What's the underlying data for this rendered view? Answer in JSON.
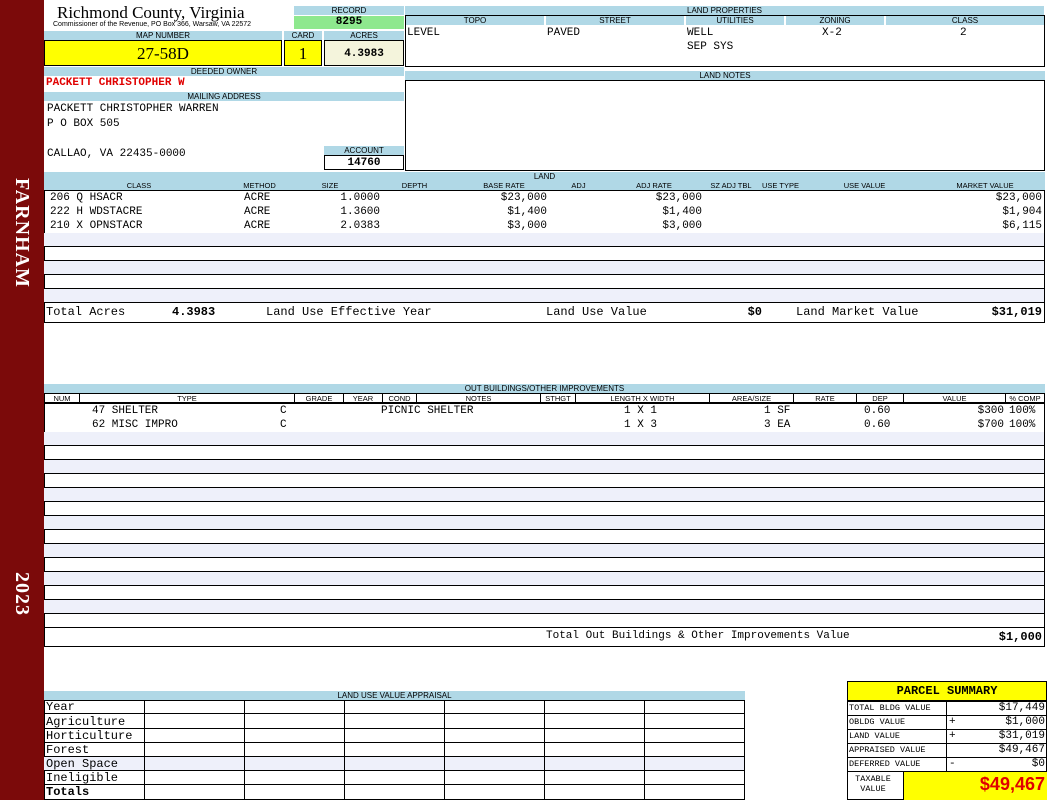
{
  "sidebar": {
    "district": "FARNHAM",
    "year": "2023"
  },
  "county": {
    "title": "Richmond County, Virginia",
    "subtitle": "Commissioner of the Revenue, PO Box 366, Warsaw, VA 22572"
  },
  "record": {
    "label": "RECORD",
    "value": "8295"
  },
  "map": {
    "label": "MAP NUMBER",
    "value": "27-58D"
  },
  "card": {
    "label": "CARD",
    "value": "1"
  },
  "acres": {
    "label": "ACRES",
    "value": "4.3983"
  },
  "land_properties": {
    "label": "LAND PROPERTIES",
    "topo_label": "TOPO",
    "street_label": "STREET",
    "utilities_label": "UTILITIES",
    "zoning_label": "ZONING",
    "class_label": "CLASS",
    "topo": "LEVEL",
    "street": "PAVED",
    "utilities_1": "WELL",
    "utilities_2": "SEP SYS",
    "zoning": "X-2",
    "class": "2"
  },
  "owner": {
    "label": "DEEDED OWNER",
    "name": "PACKETT CHRISTOPHER W"
  },
  "mailing": {
    "label": "MAILING ADDRESS",
    "line1": "PACKETT CHRISTOPHER WARREN",
    "line2": "P O BOX 505",
    "line3": "CALLAO, VA 22435-0000"
  },
  "account": {
    "label": "ACCOUNT",
    "value": "14760"
  },
  "land_notes": {
    "label": "LAND NOTES"
  },
  "land": {
    "label": "LAND",
    "headers": {
      "class": "CLASS",
      "method": "METHOD",
      "size": "SIZE",
      "depth": "DEPTH",
      "base_rate": "BASE RATE",
      "adj": "ADJ",
      "adj_rate": "ADJ RATE",
      "sz_adj_tbl": "SZ ADJ TBL",
      "use_type": "USE TYPE",
      "use_value": "USE VALUE",
      "market_value": "MARKET VALUE"
    },
    "rows": [
      {
        "class": "206 Q HSACR",
        "method": "ACRE",
        "size": "1.0000",
        "base_rate": "$23,000",
        "adj_rate": "$23,000",
        "market_value": "$23,000"
      },
      {
        "class": "222 H WDSTACRE",
        "method": "ACRE",
        "size": "1.3600",
        "base_rate": "$1,400",
        "adj_rate": "$1,400",
        "market_value": "$1,904"
      },
      {
        "class": "210 X OPNSTACR",
        "method": "ACRE",
        "size": "2.0383",
        "base_rate": "$3,000",
        "adj_rate": "$3,000",
        "market_value": "$6,115"
      }
    ],
    "total_acres_label": "Total Acres",
    "total_acres": "4.3983",
    "use_year_label": "Land Use Effective Year",
    "use_value_label": "Land Use Value",
    "use_value": "$0",
    "market_value_label": "Land Market Value",
    "market_value": "$31,019"
  },
  "outbuildings": {
    "label": "OUT BUILDINGS/OTHER IMPROVEMENTS",
    "headers": {
      "num": "NUM",
      "type": "TYPE",
      "grade": "GRADE",
      "year": "YEAR",
      "cond": "COND",
      "notes": "NOTES",
      "sthgt": "STHGT",
      "lxw": "LENGTH X WIDTH",
      "area": "AREA/SIZE",
      "rate": "RATE",
      "dep": "DEP",
      "value": "VALUE",
      "comp": "% COMP"
    },
    "rows": [
      {
        "type": "47 SHELTER",
        "grade": "C",
        "notes": "PICNIC SHELTER",
        "lxw": "1 X 1",
        "area": "1 SF",
        "dep": "0.60",
        "value": "$300",
        "comp": "100%"
      },
      {
        "type": "62 MISC IMPRO",
        "grade": "C",
        "notes": "",
        "lxw": "1 X 3",
        "area": "3 EA",
        "dep": "0.60",
        "value": "$700",
        "comp": "100%"
      }
    ],
    "total_label": "Total Out Buildings & Other Improvements Value",
    "total": "$1,000"
  },
  "land_use_appraisal": {
    "label": "LAND USE VALUE APPRAISAL",
    "rows": [
      "Year",
      "Agriculture",
      "Horticulture",
      "Forest",
      "Open Space",
      "Ineligible",
      "Totals"
    ]
  },
  "parcel_summary": {
    "title": "PARCEL SUMMARY",
    "rows": [
      {
        "label": "TOTAL BLDG VALUE",
        "sign": "",
        "value": "$17,449"
      },
      {
        "label": "OBLDG VALUE",
        "sign": "+",
        "value": "$1,000"
      },
      {
        "label": "LAND VALUE",
        "sign": "+",
        "value": "$31,019"
      },
      {
        "label": "APPRAISED VALUE",
        "sign": "",
        "value": "$49,467"
      },
      {
        "label": "DEFERRED VALUE",
        "sign": "-",
        "value": "$0"
      }
    ],
    "taxable_label_1": "TAXABLE",
    "taxable_label_2": "VALUE",
    "taxable_value": "$49,467"
  },
  "colors": {
    "sidebar": "#7b0a0a",
    "header": "#b0d8e6",
    "highlight": "#ffff00",
    "record": "#8ee88e",
    "owner_text": "#e00000"
  }
}
